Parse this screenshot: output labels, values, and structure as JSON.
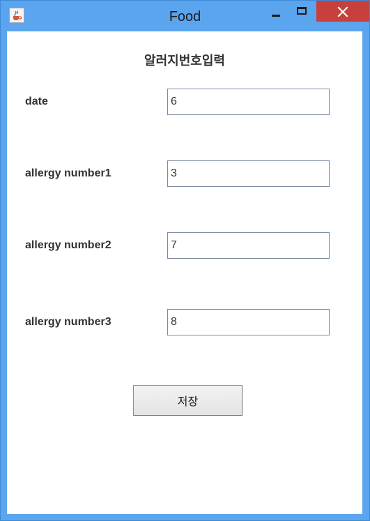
{
  "window": {
    "title": "Food",
    "icons": {
      "app": "java-cup-icon",
      "minimize": "minimize-icon",
      "maximize": "maximize-icon",
      "close": "close-icon"
    },
    "colors": {
      "frame": "#5ba4ee",
      "close_button": "#c7403c"
    }
  },
  "form": {
    "heading": "알러지번호입력",
    "fields": [
      {
        "label": "date",
        "value": "6"
      },
      {
        "label": "allergy number1",
        "value": "3"
      },
      {
        "label": "allergy number2",
        "value": "7"
      },
      {
        "label": "allergy number3",
        "value": "8"
      }
    ],
    "save_label": "저장"
  }
}
